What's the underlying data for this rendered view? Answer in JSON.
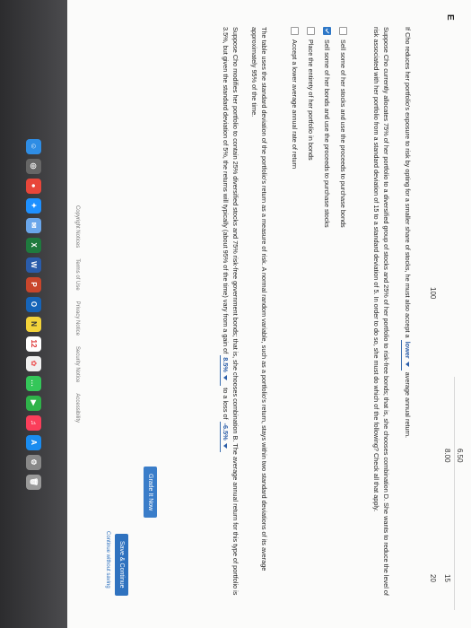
{
  "header_letter": "E",
  "table": {
    "row1": [
      "6.50"
    ],
    "row2": [
      "8.00",
      "15"
    ],
    "row3": [
      "100",
      "20"
    ]
  },
  "paragraph1": {
    "before": "If Cho reduces her portfolio's exposure to risk by opting for a smaller share of stocks, he must also accept a",
    "select_value": "lower",
    "after": "average annual return."
  },
  "paragraph2": "Suppose Cho currently allocates 75% of her portfolio to a diversified group of stocks and 25% of her portfolio to risk-free bonds; that is, she chooses combination D. She wants to reduce the level of risk associated with her portfolio from a standard deviation of 15 to a standard deviation of 5. In order to do so, she must do which of the following? Check all that apply.",
  "options": [
    {
      "label": "Sell some of her stocks and use the proceeds to purchase bonds",
      "checked": false
    },
    {
      "label": "Sell some of her bonds and use the proceeds to purchase stocks",
      "checked": true
    },
    {
      "label": "Place the entirety of her portfolio in bonds",
      "checked": false
    },
    {
      "label": "Accept a lower average annual rate of return",
      "checked": false
    }
  ],
  "paragraph3": "The table uses the standard deviation of the portfolio's return as a measure of risk. A normal random variable, such as a portfolio's return, stays within two standard deviations of its average approximately 95% of the time.",
  "paragraph4": {
    "text": "Suppose Cho modifies her portfolio to contain 25% diversified stocks and 75% risk-free government bonds; that is, she chooses combination B. The average annual return for this type of portfolio is 3.5%, but given the standard deviation of 5%, the returns will typically (about 95% of the time) vary from a gain of",
    "gain_value": "8.5%",
    "middle": "to a loss of",
    "loss_value": "-6.5%"
  },
  "buttons": {
    "grade": "Grade It Now",
    "save": "Save & Continue",
    "continue_without": "Continue without saving"
  },
  "footer": [
    "Copyright Notices",
    "Terms of Use",
    "Privacy Notice",
    "Security Notice",
    "Accessibility"
  ],
  "dock": {
    "calendar_day": "12",
    "icons": [
      "finder-icon",
      "launchpad-icon",
      "chrome-icon",
      "safari-icon",
      "mail-icon",
      "excel-icon",
      "word-icon",
      "powerpoint-icon",
      "outlook-icon",
      "notes-icon",
      "calendar-icon",
      "photos-icon",
      "messages-icon",
      "facetime-icon",
      "music-icon",
      "app-store-icon",
      "preferences-icon",
      "trash-icon"
    ]
  }
}
